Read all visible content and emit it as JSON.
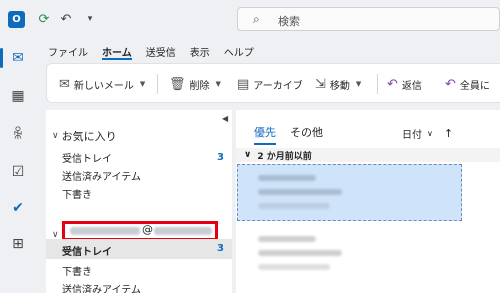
{
  "titlebar": {
    "app_logo_letter": "O",
    "search_placeholder": "検索",
    "icons": [
      "outlook-logo-icon",
      "sync-icon",
      "undo-icon",
      "customize-quick-access-icon",
      "search-icon"
    ]
  },
  "rail": {
    "items": [
      {
        "name": "mail-icon",
        "glyph": "✉",
        "active": true
      },
      {
        "name": "calendar-icon",
        "glyph": "▦"
      },
      {
        "name": "people-icon",
        "glyph": "👥"
      },
      {
        "name": "tasks-icon",
        "glyph": "☑"
      },
      {
        "name": "todo-icon",
        "glyph": "✔"
      },
      {
        "name": "apps-icon",
        "glyph": "⊞"
      }
    ]
  },
  "menu": {
    "tabs": [
      "ファイル",
      "ホーム",
      "送受信",
      "表示",
      "ヘルプ"
    ],
    "active_tab": "ホーム"
  },
  "ribbon": {
    "new_mail": "新しいメール",
    "delete": "削除",
    "archive": "アーカイブ",
    "move": "移動",
    "reply": "返信",
    "reply_all": "全員に"
  },
  "folders": {
    "favorites_header": "お気に入り",
    "favorites": [
      {
        "label": "受信トレイ",
        "count": "3"
      },
      {
        "label": "送信済みアイテム",
        "count": ""
      },
      {
        "label": "下書き",
        "count": ""
      }
    ],
    "account_at": "@",
    "account_folders": [
      {
        "label": "受信トレイ",
        "count": "3",
        "selected": true
      },
      {
        "label": "下書き",
        "count": ""
      },
      {
        "label": "送信済みアイテム",
        "count": ""
      }
    ]
  },
  "messages": {
    "tab_focused": "優先",
    "tab_other": "その他",
    "sort_label": "日付",
    "sort_arrow": "↑",
    "group_header": "2 か月前以前"
  },
  "colors": {
    "accent": "#0f6cbd",
    "selection": "#cfe4fa",
    "highlight_box": "#e60012"
  }
}
